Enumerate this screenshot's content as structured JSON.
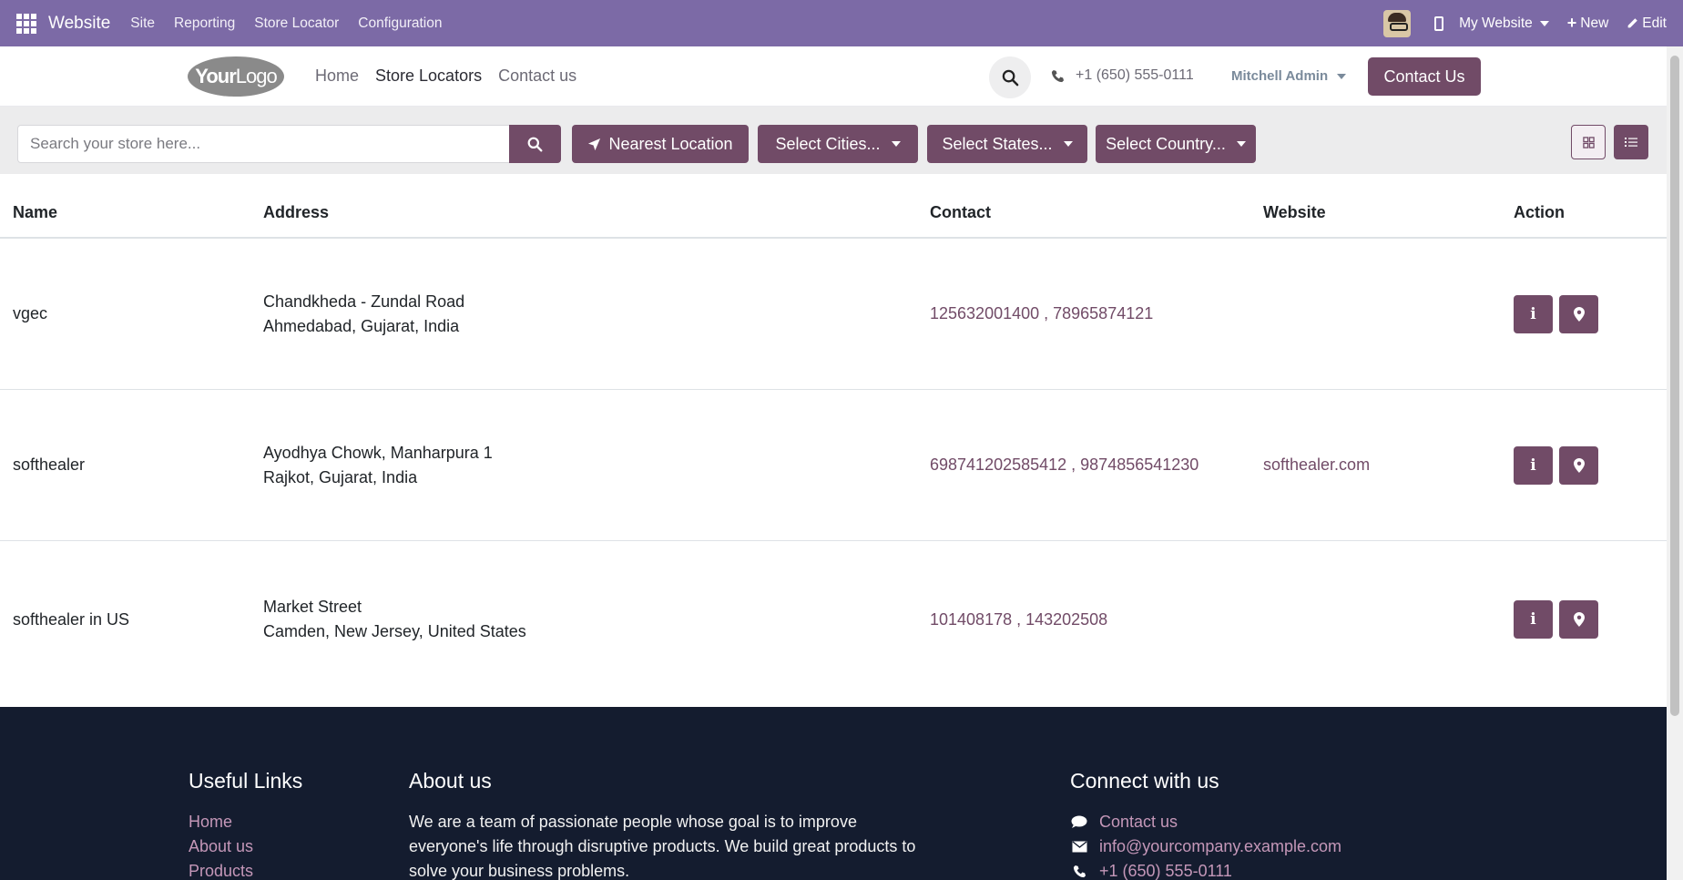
{
  "topbar": {
    "brand": "Website",
    "menu": [
      "Site",
      "Reporting",
      "Store Locator",
      "Configuration"
    ],
    "website_selector": "My Website",
    "new_label": "New",
    "edit_label": "Edit"
  },
  "header": {
    "logo_bold": "Your",
    "logo_thin": "Logo",
    "nav": [
      "Home",
      "Store Locators",
      "Contact us"
    ],
    "phone": "+1 (650) 555-0111",
    "user": "Mitchell Admin",
    "contact_button": "Contact Us"
  },
  "toolbar": {
    "search_placeholder": "Search your store here...",
    "nearest_label": "Nearest Location",
    "cities_label": "Select Cities...",
    "states_label": "Select States...",
    "country_label": "Select Country..."
  },
  "table": {
    "columns": [
      "Name",
      "Address",
      "Contact",
      "Website",
      "Action"
    ],
    "rows": [
      {
        "name": "vgec",
        "address1": "Chandkheda - Zundal Road",
        "address2": "Ahmedabad, Gujarat, India",
        "contact": "125632001400 , 78965874121",
        "website": ""
      },
      {
        "name": "softhealer",
        "address1": "Ayodhya Chowk, Manharpura 1",
        "address2": "Rajkot, Gujarat, India",
        "contact": "698741202585412 , 9874856541230",
        "website": "softhealer.com"
      },
      {
        "name": "softhealer in US",
        "address1": "Market Street",
        "address2": "Camden, New Jersey, United States",
        "contact": "101408178 , 143202508",
        "website": ""
      }
    ]
  },
  "footer": {
    "useful_links_title": "Useful Links",
    "useful_links": [
      "Home",
      "About us",
      "Products"
    ],
    "about_title": "About us",
    "about_text": "We are a team of passionate people whose goal is to improve everyone's life through disruptive products. We build great products to solve your business problems.",
    "connect_title": "Connect with us",
    "connect_contact": "Contact us",
    "connect_email": "info@yourcompany.example.com",
    "connect_phone": "+1 (650) 555-0111"
  },
  "colors": {
    "admin_bar": "#7c6aa6",
    "primary": "#714b67",
    "footer_bg": "#141c2f",
    "footer_link": "#c497b8"
  }
}
